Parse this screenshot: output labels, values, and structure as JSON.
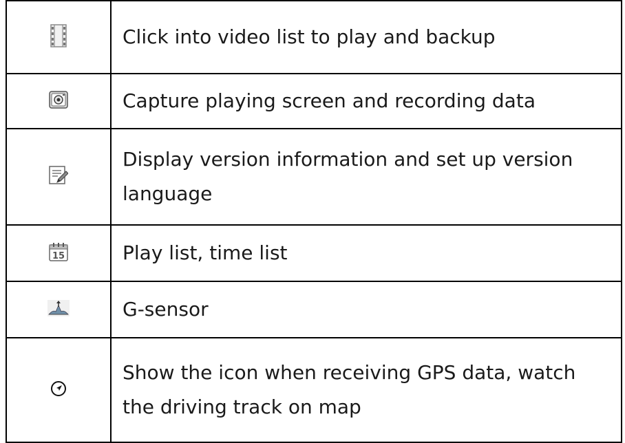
{
  "rows": [
    {
      "icon": "film-strip-icon",
      "text": "Click into video list to play and backup"
    },
    {
      "icon": "camera-capture-icon",
      "text": "Capture playing screen and recording data"
    },
    {
      "icon": "edit-note-icon",
      "text": "Display version information and set up version language"
    },
    {
      "icon": "calendar-15-icon",
      "text": "Play list, time list",
      "calendar_number": "15"
    },
    {
      "icon": "g-sensor-icon",
      "text": "G-sensor"
    },
    {
      "icon": "gps-navigation-icon",
      "text": "Show the icon when receiving GPS data, watch the driving track on map"
    }
  ]
}
